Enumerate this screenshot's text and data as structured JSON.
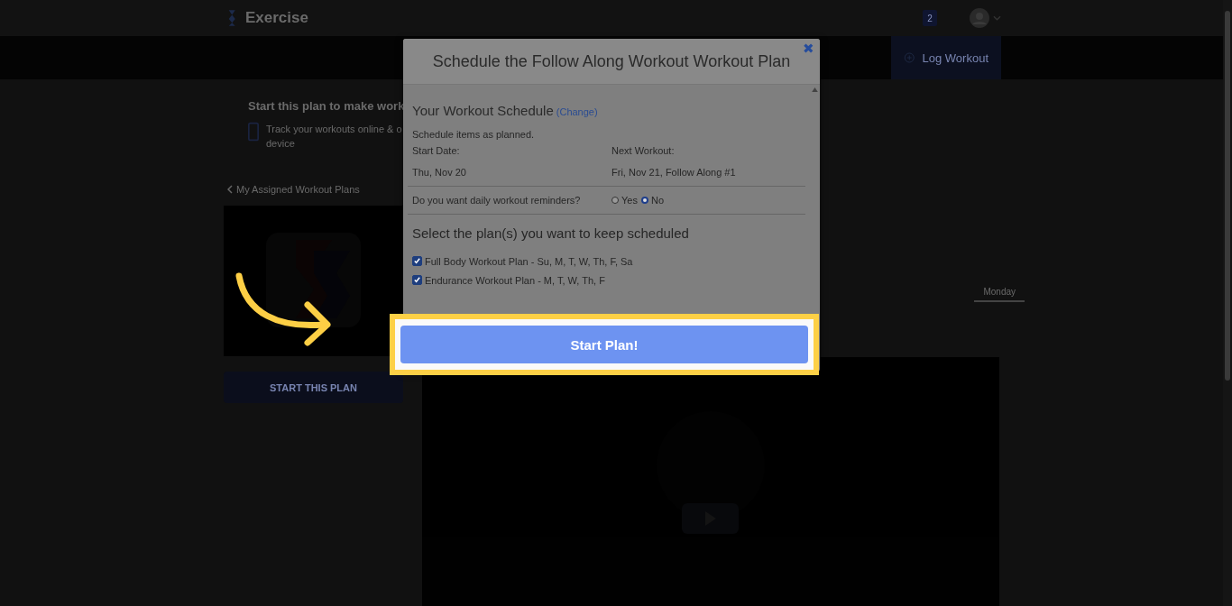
{
  "header": {
    "app_name": "Exercise",
    "badge": "2"
  },
  "toolbar": {
    "log_button": "Log Workout"
  },
  "plan_intro": {
    "heading": "Start this plan to make work",
    "text_lines": [
      "Track your workouts online & o",
      "device"
    ]
  },
  "back_link": "My Assigned Workout Plans",
  "start_button": "START THIS PLAN",
  "day_tab": {
    "label": "Monday",
    "selected": true
  },
  "modal": {
    "title": "Schedule the Follow Along Workout Workout Plan",
    "close": "✖",
    "schedule_heading": "Your Workout Schedule",
    "change_link": "(Change)",
    "note": "Schedule items as planned.",
    "start_label": "Start Date:",
    "start_value": "Thu, Nov 20",
    "next_label": "Next Workout:",
    "next_value": "Fri, Nov 21, Follow Along #1",
    "reminder_question": "Do you want daily workout reminders?",
    "reminder_options": [
      {
        "label": "Yes",
        "selected": false
      },
      {
        "label": "No",
        "selected": true
      }
    ],
    "plans_heading": "Select the plan(s) you want to keep scheduled",
    "plans": [
      {
        "label": "Full Body Workout Plan - Su, M, T, W, Th, F, Sa",
        "checked": true
      },
      {
        "label": "Endurance Workout Plan - M, T, W, Th, F",
        "checked": true
      }
    ],
    "submit": "Start Plan!"
  }
}
